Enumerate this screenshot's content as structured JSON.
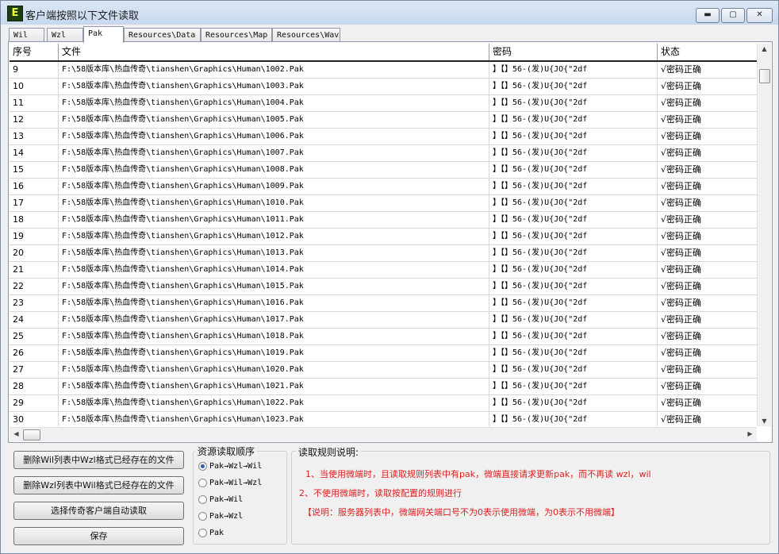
{
  "window": {
    "title": "客户端按照以下文件读取",
    "icon_letter": "E"
  },
  "tabs": [
    "Wil",
    "Wzl",
    "Pak",
    "Resources\\Data",
    "Resources\\Map",
    "Resources\\Wav"
  ],
  "active_tab": "Pak",
  "table": {
    "columns": [
      "序号",
      "文件",
      "密码",
      "状态"
    ],
    "rows": [
      {
        "n": "9",
        "file": "F:\\58版本库\\热血传奇\\tianshen\\Graphics\\Human\\1002.Pak",
        "pwd": "】【】56-(发)U{JO{\"2df",
        "status": "√密码正确"
      },
      {
        "n": "10",
        "file": "F:\\58版本库\\热血传奇\\tianshen\\Graphics\\Human\\1003.Pak",
        "pwd": "】【】56-(发)U{JO{\"2df",
        "status": "√密码正确"
      },
      {
        "n": "11",
        "file": "F:\\58版本库\\热血传奇\\tianshen\\Graphics\\Human\\1004.Pak",
        "pwd": "】【】56-(发)U{JO{\"2df",
        "status": "√密码正确"
      },
      {
        "n": "12",
        "file": "F:\\58版本库\\热血传奇\\tianshen\\Graphics\\Human\\1005.Pak",
        "pwd": "】【】56-(发)U{JO{\"2df",
        "status": "√密码正确"
      },
      {
        "n": "13",
        "file": "F:\\58版本库\\热血传奇\\tianshen\\Graphics\\Human\\1006.Pak",
        "pwd": "】【】56-(发)U{JO{\"2df",
        "status": "√密码正确"
      },
      {
        "n": "14",
        "file": "F:\\58版本库\\热血传奇\\tianshen\\Graphics\\Human\\1007.Pak",
        "pwd": "】【】56-(发)U{JO{\"2df",
        "status": "√密码正确"
      },
      {
        "n": "15",
        "file": "F:\\58版本库\\热血传奇\\tianshen\\Graphics\\Human\\1008.Pak",
        "pwd": "】【】56-(发)U{JO{\"2df",
        "status": "√密码正确"
      },
      {
        "n": "16",
        "file": "F:\\58版本库\\热血传奇\\tianshen\\Graphics\\Human\\1009.Pak",
        "pwd": "】【】56-(发)U{JO{\"2df",
        "status": "√密码正确"
      },
      {
        "n": "17",
        "file": "F:\\58版本库\\热血传奇\\tianshen\\Graphics\\Human\\1010.Pak",
        "pwd": "】【】56-(发)U{JO{\"2df",
        "status": "√密码正确"
      },
      {
        "n": "18",
        "file": "F:\\58版本库\\热血传奇\\tianshen\\Graphics\\Human\\1011.Pak",
        "pwd": "】【】56-(发)U{JO{\"2df",
        "status": "√密码正确"
      },
      {
        "n": "19",
        "file": "F:\\58版本库\\热血传奇\\tianshen\\Graphics\\Human\\1012.Pak",
        "pwd": "】【】56-(发)U{JO{\"2df",
        "status": "√密码正确"
      },
      {
        "n": "20",
        "file": "F:\\58版本库\\热血传奇\\tianshen\\Graphics\\Human\\1013.Pak",
        "pwd": "】【】56-(发)U{JO{\"2df",
        "status": "√密码正确"
      },
      {
        "n": "21",
        "file": "F:\\58版本库\\热血传奇\\tianshen\\Graphics\\Human\\1014.Pak",
        "pwd": "】【】56-(发)U{JO{\"2df",
        "status": "√密码正确"
      },
      {
        "n": "22",
        "file": "F:\\58版本库\\热血传奇\\tianshen\\Graphics\\Human\\1015.Pak",
        "pwd": "】【】56-(发)U{JO{\"2df",
        "status": "√密码正确"
      },
      {
        "n": "23",
        "file": "F:\\58版本库\\热血传奇\\tianshen\\Graphics\\Human\\1016.Pak",
        "pwd": "】【】56-(发)U{JO{\"2df",
        "status": "√密码正确"
      },
      {
        "n": "24",
        "file": "F:\\58版本库\\热血传奇\\tianshen\\Graphics\\Human\\1017.Pak",
        "pwd": "】【】56-(发)U{JO{\"2df",
        "status": "√密码正确"
      },
      {
        "n": "25",
        "file": "F:\\58版本库\\热血传奇\\tianshen\\Graphics\\Human\\1018.Pak",
        "pwd": "】【】56-(发)U{JO{\"2df",
        "status": "√密码正确"
      },
      {
        "n": "26",
        "file": "F:\\58版本库\\热血传奇\\tianshen\\Graphics\\Human\\1019.Pak",
        "pwd": "】【】56-(发)U{JO{\"2df",
        "status": "√密码正确"
      },
      {
        "n": "27",
        "file": "F:\\58版本库\\热血传奇\\tianshen\\Graphics\\Human\\1020.Pak",
        "pwd": "】【】56-(发)U{JO{\"2df",
        "status": "√密码正确"
      },
      {
        "n": "28",
        "file": "F:\\58版本库\\热血传奇\\tianshen\\Graphics\\Human\\1021.Pak",
        "pwd": "】【】56-(发)U{JO{\"2df",
        "status": "√密码正确"
      },
      {
        "n": "29",
        "file": "F:\\58版本库\\热血传奇\\tianshen\\Graphics\\Human\\1022.Pak",
        "pwd": "】【】56-(发)U{JO{\"2df",
        "status": "√密码正确"
      },
      {
        "n": "30",
        "file": "F:\\58版本库\\热血传奇\\tianshen\\Graphics\\Human\\1023.Pak",
        "pwd": "】【】56-(发)U{JO{\"2df",
        "status": "√密码正确"
      }
    ]
  },
  "buttons": {
    "delete_wil": "删除Wil列表中Wzl格式已经存在的文件",
    "delete_wzl": "删除Wzl列表中Wil格式已经存在的文件",
    "auto_read": "选择传奇客户端自动读取",
    "save": "保存"
  },
  "order": {
    "title": "资源读取顺序",
    "options": [
      "Pak→Wzl→Wil",
      "Pak→Wil→Wzl",
      "Pak→Wil",
      "Pak→Wzl",
      "Pak"
    ],
    "selected": "Pak→Wzl→Wil"
  },
  "rules": {
    "title": "读取规则说明:",
    "lines": [
      "1、当使用微端时，且读取规则列表中有pak，微端直接请求更新pak，而不再读 wzl，wil",
      "2、不使用微端时，读取按配置的规则进行",
      "【说明：服务器列表中，微端网关端口号不为0表示使用微端，为0表示不用微端】"
    ]
  },
  "colors": {
    "note_red": "#e02020"
  }
}
